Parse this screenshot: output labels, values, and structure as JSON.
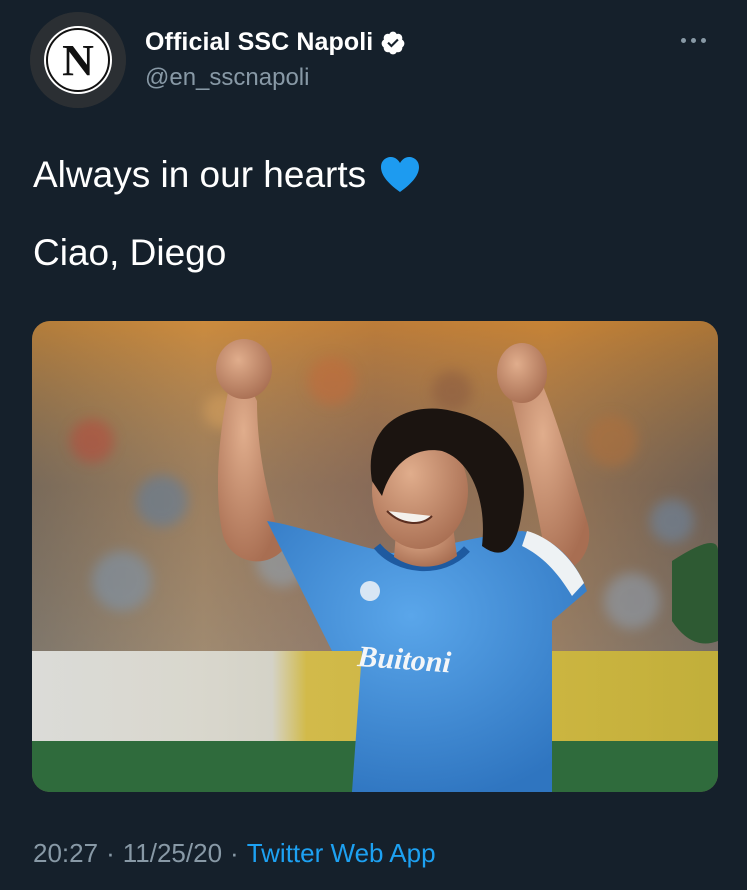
{
  "author": {
    "display_name": "Official SSC Napoli",
    "handle": "@en_sscnapoli",
    "avatar_letter": "N",
    "verified": true
  },
  "tweet": {
    "line1": "Always in our hearts",
    "line1_emoji": "blue-heart-icon",
    "line2": "Ciao, Diego"
  },
  "media": {
    "jersey_text": "Buitoni"
  },
  "meta": {
    "time": "20:27",
    "separator": "·",
    "date": "11/25/20",
    "source": "Twitter Web App"
  },
  "colors": {
    "background": "#15202b",
    "text": "#ffffff",
    "muted": "#8899a6",
    "link": "#1da1f2",
    "jersey": "#3f8fd8"
  }
}
